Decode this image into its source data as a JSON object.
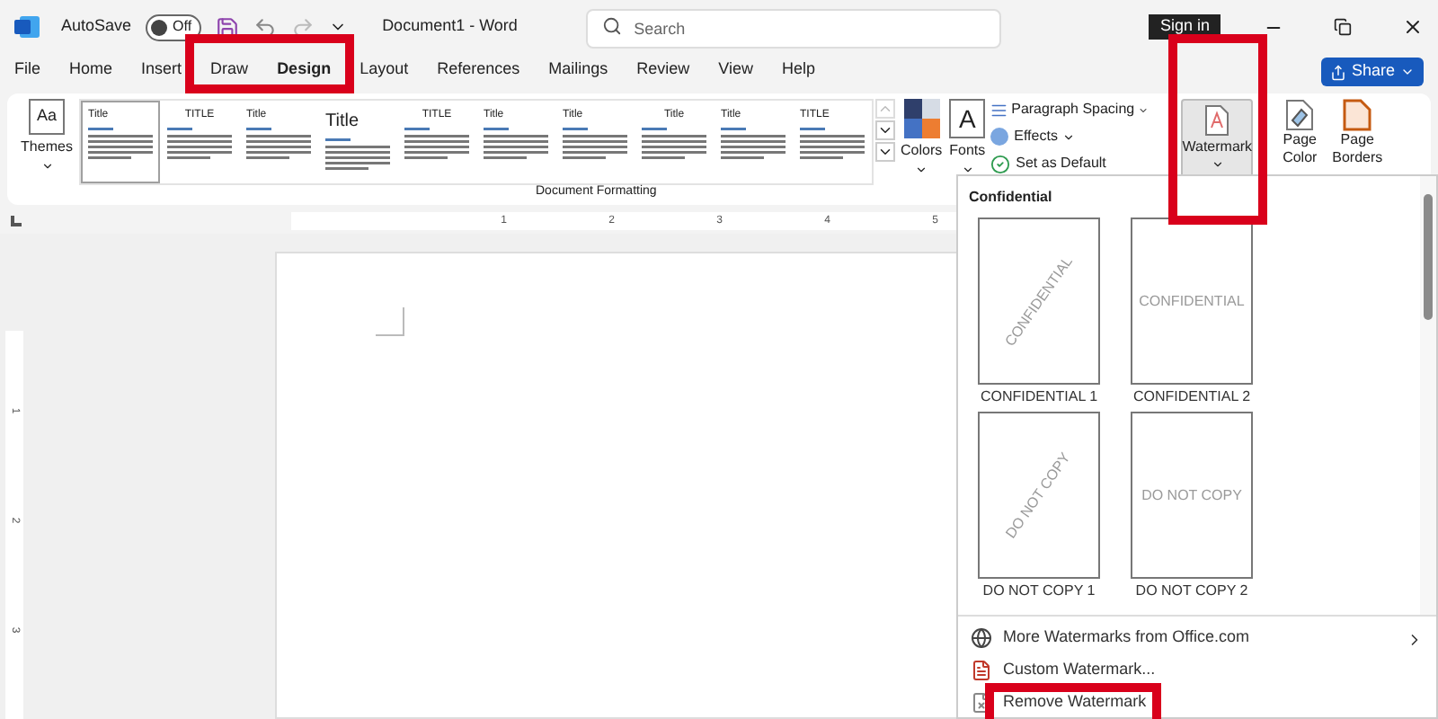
{
  "title_bar": {
    "autosave_label": "AutoSave",
    "autosave": {
      "on": false,
      "label": "Off"
    },
    "document_title": "Document1 - Word",
    "search": {
      "placeholder": "Search"
    },
    "sign_in": "Sign in"
  },
  "tabs": [
    {
      "label": "File",
      "selected": false
    },
    {
      "label": "Home",
      "selected": false
    },
    {
      "label": "Insert",
      "selected": false
    },
    {
      "label": "Draw",
      "selected": false
    },
    {
      "label": "Design",
      "selected": true
    },
    {
      "label": "Layout",
      "selected": false
    },
    {
      "label": "References",
      "selected": false
    },
    {
      "label": "Mailings",
      "selected": false
    },
    {
      "label": "Review",
      "selected": false
    },
    {
      "label": "View",
      "selected": false
    },
    {
      "label": "Help",
      "selected": false
    }
  ],
  "share": "Share",
  "ribbon": {
    "themes_glyph": "Aa",
    "themes": "Themes",
    "style_gallery": [
      {
        "title": "Title",
        "selected": true
      },
      {
        "title": "TITLE",
        "selected": false
      },
      {
        "title": "Title",
        "selected": false
      },
      {
        "title": "Title",
        "selected": false
      },
      {
        "title": "TITLE",
        "selected": false
      },
      {
        "title": "Title",
        "selected": false
      },
      {
        "title": "Title",
        "selected": false
      },
      {
        "title": "Title",
        "selected": false
      },
      {
        "title": "Title",
        "selected": false
      },
      {
        "title": "TITLE",
        "selected": false
      }
    ],
    "colors": "Colors",
    "fonts_glyph": "A",
    "fonts": "Fonts",
    "paragraph_spacing": "Paragraph Spacing",
    "effects": "Effects",
    "set_as_default": "Set as Default",
    "watermark": {
      "label": "Watermark",
      "pressed": true
    },
    "page_color": "Page Color",
    "page_borders": "Page Borders",
    "group_label": "Document Formatting"
  },
  "ruler": {
    "numbers": [
      "1",
      "2",
      "3",
      "4",
      "5"
    ],
    "vertical_numbers": [
      "1",
      "2",
      "3"
    ]
  },
  "watermark_menu": {
    "section": "Confidential",
    "items": [
      {
        "label": "CONFIDENTIAL 1",
        "watermark_text": "CONFIDENTIAL",
        "diagonal": true
      },
      {
        "label": "CONFIDENTIAL 2",
        "watermark_text": "CONFIDENTIAL",
        "diagonal": false
      },
      {
        "label": "DO NOT COPY 1",
        "watermark_text": "DO NOT COPY",
        "diagonal": true
      },
      {
        "label": "DO NOT COPY 2",
        "watermark_text": "DO NOT COPY",
        "diagonal": false
      }
    ],
    "actions": [
      {
        "label": "More Watermarks from Office.com",
        "kind": "submenu"
      },
      {
        "label": "Custom Watermark...",
        "kind": "custom"
      },
      {
        "label": "Remove Watermark",
        "kind": "remove"
      }
    ]
  },
  "highlight_frames": [
    {
      "kind": "design_tab"
    },
    {
      "kind": "watermark_button"
    },
    {
      "kind": "remove_item"
    }
  ]
}
